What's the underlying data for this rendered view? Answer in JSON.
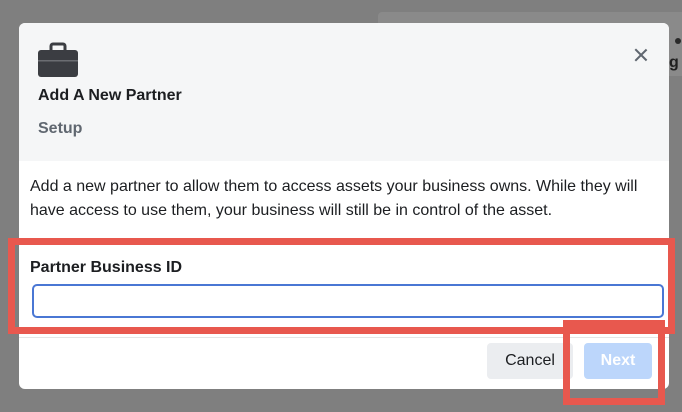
{
  "background": {
    "peek_text": "g"
  },
  "modal": {
    "icon": "briefcase-icon",
    "title": "Add A New Partner",
    "subtitle": "Setup",
    "close_icon": "close-icon",
    "description": "Add a new partner to allow them to access assets your business owns. While they will have access to use them, your business will still be in control of the asset.",
    "field": {
      "label": "Partner Business ID",
      "value": "",
      "placeholder": ""
    },
    "buttons": {
      "cancel_label": "Cancel",
      "next_label": "Next",
      "next_disabled": true
    }
  },
  "colors": {
    "highlight": "#e8584e",
    "accent_border": "#4a77d4",
    "next_disabled_bg": "#bcd6fb"
  }
}
